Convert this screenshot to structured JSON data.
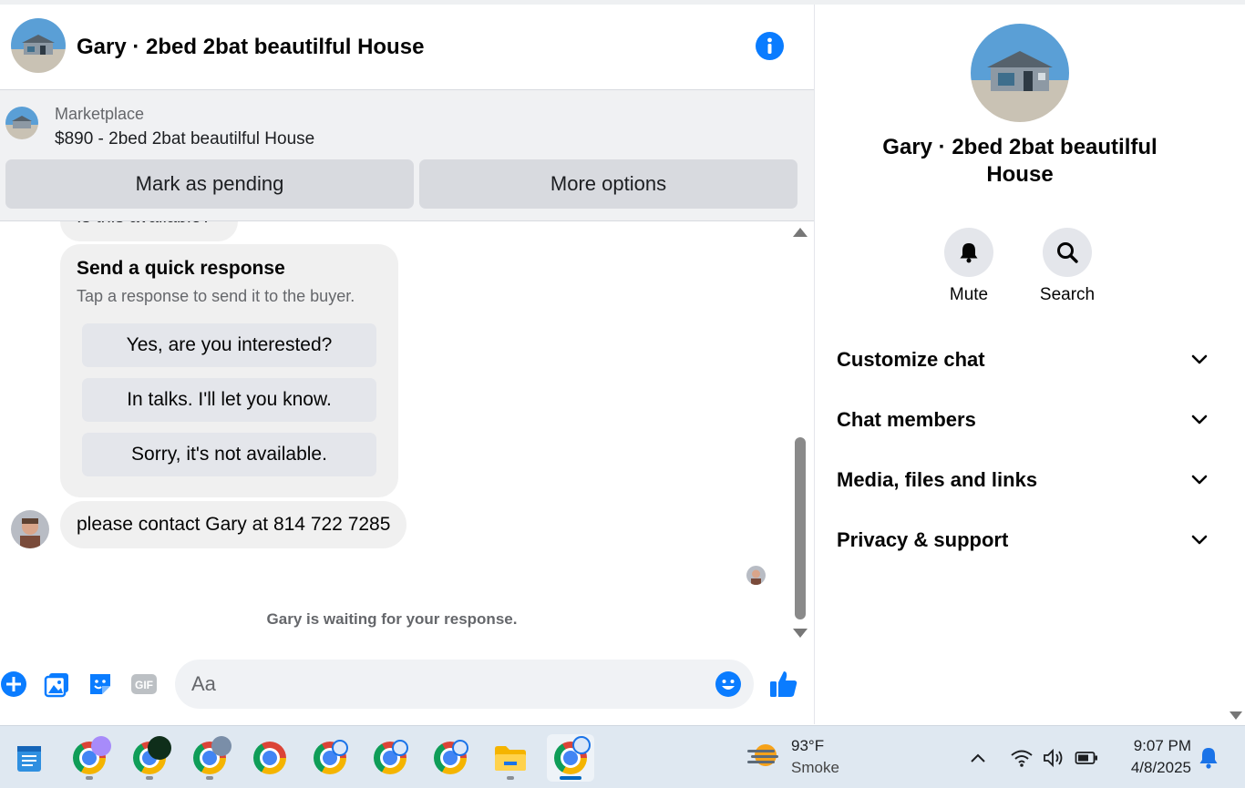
{
  "chat": {
    "title": "Gary · 2bed 2bat beautilful House",
    "listing": {
      "category": "Marketplace",
      "price_title": "$890 - 2bed 2bat beautilful House",
      "mark_pending_label": "Mark as pending",
      "more_options_label": "More options"
    },
    "messages": {
      "partial_text": "Is this available?",
      "quick_response": {
        "title": "Send a quick response",
        "subtitle": "Tap a response to send it to the buyer.",
        "options": [
          "Yes, are you interested?",
          "In talks. I'll let you know.",
          "Sorry, it's not available."
        ]
      },
      "contact_text": "please contact Gary at 814 722 7285",
      "waiting_text": "Gary is waiting for your response."
    },
    "composer": {
      "placeholder": "Aa"
    }
  },
  "info_panel": {
    "name": "Gary · 2bed 2bat beautilful House",
    "mute_label": "Mute",
    "search_label": "Search",
    "sections": [
      "Customize chat",
      "Chat members",
      "Media, files and links",
      "Privacy & support"
    ]
  },
  "taskbar": {
    "weather_temp": "93°F",
    "weather_desc": "Smoke",
    "time": "9:07 PM",
    "date": "4/8/2025"
  },
  "colors": {
    "accent": "#0a7cff",
    "bubble": "#f0f0f0",
    "button_grey": "#d8dadf"
  }
}
